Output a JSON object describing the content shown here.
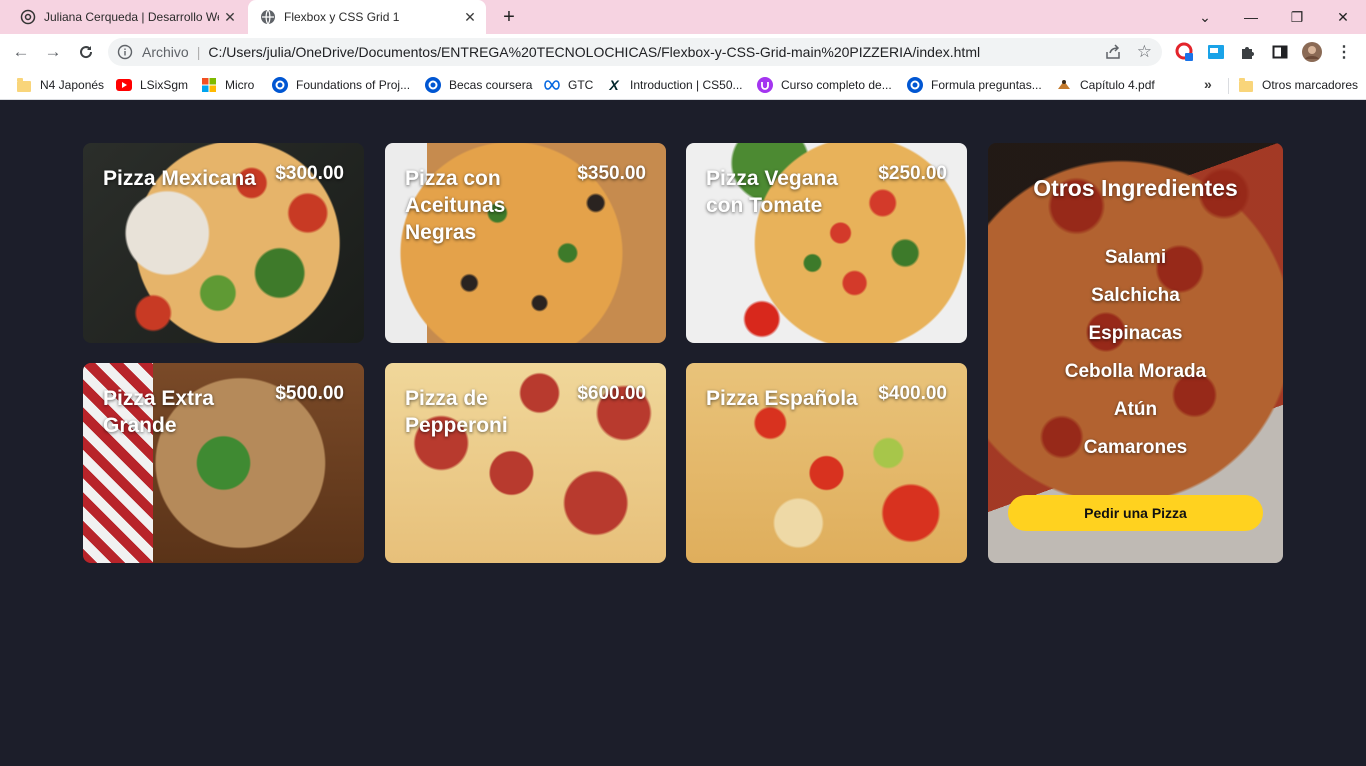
{
  "browser": {
    "tabs": [
      {
        "title": "Juliana Cerqueda | Desarrollo We",
        "active": false
      },
      {
        "title": "Flexbox y CSS Grid 1",
        "active": true
      }
    ],
    "new_tab": "+",
    "window_controls": {
      "minimize": "—",
      "restore": "❐",
      "close": "✕"
    },
    "address": {
      "scheme_label": "Archivo",
      "url": "C:/Users/julia/OneDrive/Documentos/ENTREGA%20TECNOLOCHICAS/Flexbox-y-CSS-Grid-main%20PIZZERIA/index.html"
    },
    "bookmarks": [
      {
        "label": "N4 Japonés",
        "icon": "folder-icon"
      },
      {
        "label": "LSixSgm",
        "icon": "youtube-icon"
      },
      {
        "label": "Micro",
        "icon": "microsoft-icon"
      },
      {
        "label": "Foundations of Proj...",
        "icon": "coursera-icon"
      },
      {
        "label": "Becas coursera",
        "icon": "coursera-icon"
      },
      {
        "label": "GTC",
        "icon": "meta-icon"
      },
      {
        "label": "Introduction | CS50...",
        "icon": "edx-icon"
      },
      {
        "label": "Curso completo de...",
        "icon": "udemy-icon"
      },
      {
        "label": "Formula preguntas...",
        "icon": "coursera-icon"
      },
      {
        "label": "Capítulo 4.pdf",
        "icon": "pdf-icon"
      }
    ],
    "bookmarks_overflow": "»",
    "other_bookmarks": "Otros marcadores"
  },
  "pizzas": [
    {
      "name": "Pizza Mexicana",
      "price": "$300.00"
    },
    {
      "name": "Pizza con Aceitunas Negras",
      "price": "$350.00"
    },
    {
      "name": "Pizza Vegana con Tomate",
      "price": "$250.00"
    },
    {
      "name": "Pizza Extra Grande",
      "price": "$500.00"
    },
    {
      "name": "Pizza de Pepperoni",
      "price": "$600.00"
    },
    {
      "name": "Pizza Española",
      "price": "$400.00"
    }
  ],
  "sidebar": {
    "title": "Otros Ingredientes",
    "ingredients": [
      "Salami",
      "Salchicha",
      "Espinacas",
      "Cebolla Morada",
      "Atún",
      "Camarones"
    ],
    "button": "Pedir una Pizza"
  },
  "colors": {
    "page_background": "#1c1e2a",
    "tabstrip": "#f6d3e1",
    "order_button": "#ffd21f"
  }
}
